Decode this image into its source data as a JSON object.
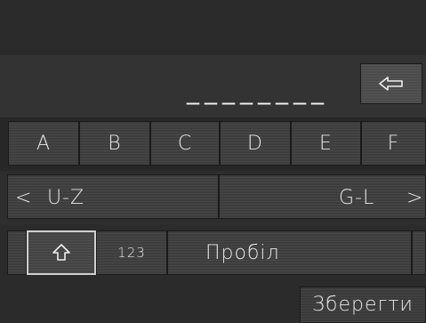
{
  "entry": {
    "value": "________"
  },
  "keyboard": {
    "letters": [
      "A",
      "B",
      "C",
      "D",
      "E",
      "F"
    ],
    "nav_left_arrow": "<",
    "nav_left_label": "U-Z",
    "nav_right_label": "G-L",
    "nav_right_arrow": ">",
    "numbers_label": "123",
    "space_label": "Пробіл"
  },
  "actions": {
    "save_label": "Зберегти"
  },
  "icons": {
    "backspace": "backspace-arrow-left-icon",
    "shift": "shift-arrow-up-icon"
  },
  "colors": {
    "background": "#2e2e2e",
    "key": "#3d3d3d",
    "text": "#e6e6e6",
    "shift_border": "#d0d0d0"
  }
}
